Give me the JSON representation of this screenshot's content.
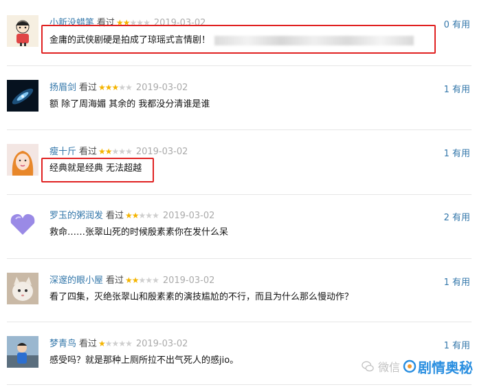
{
  "reviews": [
    {
      "user": "小新没蜡笔",
      "watched": "看过",
      "stars": 2,
      "date": "2019-03-02",
      "comment": "金庸的武侠剧硬是拍成了琼瑶式言情剧！",
      "votes": "0 有用"
    },
    {
      "user": "扬眉剑",
      "watched": "看过",
      "stars": 3,
      "date": "2019-03-02",
      "comment": "额 除了周海媚 其余的 我都没分清谁是谁",
      "votes": "1 有用"
    },
    {
      "user": "瘦十斤",
      "watched": "看过",
      "stars": 2,
      "date": "2019-03-02",
      "comment": "经典就是经典 无法超越",
      "votes": "1 有用"
    },
    {
      "user": "罗玉的粥润发",
      "watched": "看过",
      "stars": 2,
      "date": "2019-03-02",
      "comment": "救命……张翠山死的时候殷素素你在发什么呆",
      "votes": "2 有用"
    },
    {
      "user": "深邃的眼小屋",
      "watched": "看过",
      "stars": 2,
      "date": "2019-03-02",
      "comment": "看了四集，灭绝张翠山和殷素素的演技尴尬的不行，而且为什么那么慢动作？",
      "votes": "1 有用"
    },
    {
      "user": "梦青鸟",
      "watched": "看过",
      "stars": 1,
      "date": "2019-03-02",
      "comment": "感受吗？就是那种上厕所拉不出气死人的感jio。",
      "votes": "1 有用"
    }
  ],
  "watermark": {
    "prefix": "微信",
    "title": "剧情奥秘"
  },
  "colors": {
    "link": "#3377aa",
    "star": "#f4b400",
    "highlight": "#e02020",
    "brand": "#2b8fe0"
  }
}
